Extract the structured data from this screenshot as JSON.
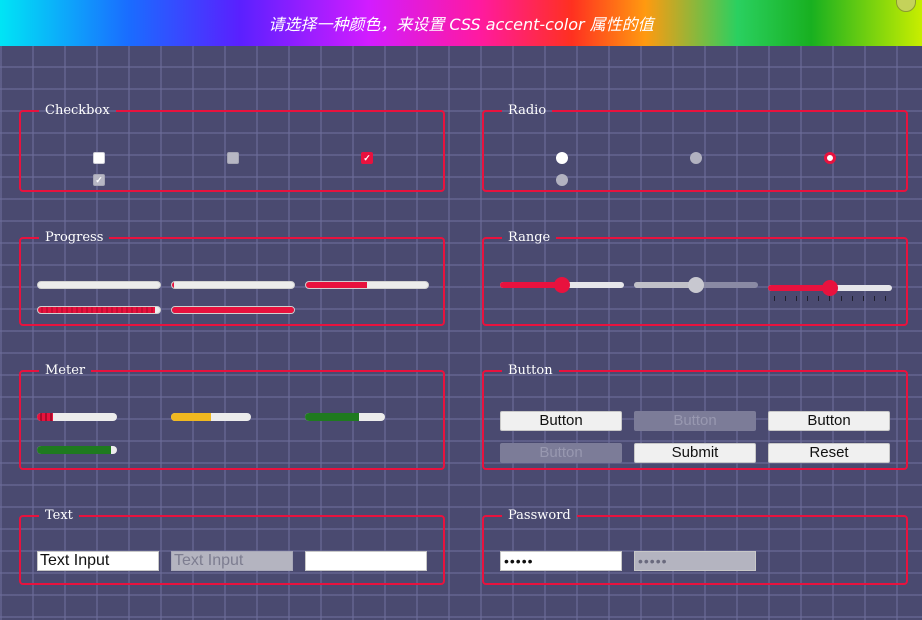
{
  "header": {
    "title": "请选择一种颜色，来设置 CSS accent-color 属性的值"
  },
  "colors": {
    "accent": "#e8123e",
    "background": "#4a4a70",
    "meter_low": "#e8123e",
    "meter_medium": "#f0b820",
    "meter_high": "#1f7a1f"
  },
  "sections": {
    "checkbox": {
      "legend": "Checkbox"
    },
    "radio": {
      "legend": "Radio"
    },
    "progress": {
      "legend": "Progress",
      "values": [
        0,
        0.02,
        0.5,
        0.96,
        1.0
      ]
    },
    "range": {
      "legend": "Range",
      "values": [
        0.5,
        0.5,
        0.5
      ]
    },
    "meter": {
      "legend": "Meter",
      "values": [
        0.2,
        0.5,
        0.68,
        0.92
      ]
    },
    "button": {
      "legend": "Button",
      "labels": [
        "Button",
        "Button",
        "Button",
        "Button",
        "Submit",
        "Reset"
      ]
    },
    "text": {
      "legend": "Text",
      "values": [
        "Text Input",
        "Text Input",
        ""
      ]
    },
    "password": {
      "legend": "Password",
      "values": [
        "•••••",
        "•••••"
      ]
    }
  }
}
